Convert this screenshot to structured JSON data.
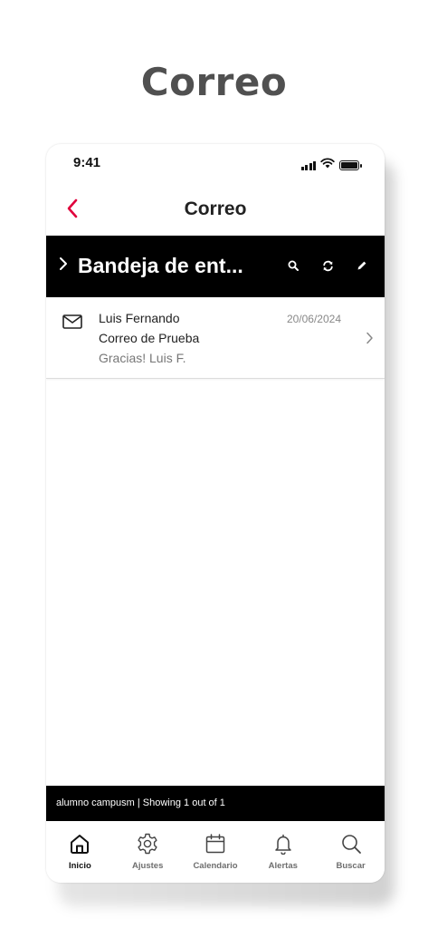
{
  "page": {
    "heading": "Correo"
  },
  "status_bar": {
    "time": "9:41"
  },
  "nav": {
    "title": "Correo",
    "accent_color": "#e0003c"
  },
  "folder": {
    "title": "Bandeja de ent...",
    "actions": [
      "search-icon",
      "refresh-icon",
      "pencil-icon"
    ]
  },
  "messages": [
    {
      "sender": "Luis Fernando",
      "subject": "Correo de Prueba",
      "preview": "Gracias! Luis F.",
      "date": "20/06/2024"
    }
  ],
  "footer": {
    "text": "alumno campusm | Showing 1 out of 1"
  },
  "tabs": [
    {
      "label": "Inicio",
      "icon": "home-icon",
      "active": true
    },
    {
      "label": "Ajustes",
      "icon": "gear-icon",
      "active": false
    },
    {
      "label": "Calendario",
      "icon": "calendar-icon",
      "active": false
    },
    {
      "label": "Alertas",
      "icon": "bell-icon",
      "active": false
    },
    {
      "label": "Buscar",
      "icon": "search-icon",
      "active": false
    }
  ]
}
